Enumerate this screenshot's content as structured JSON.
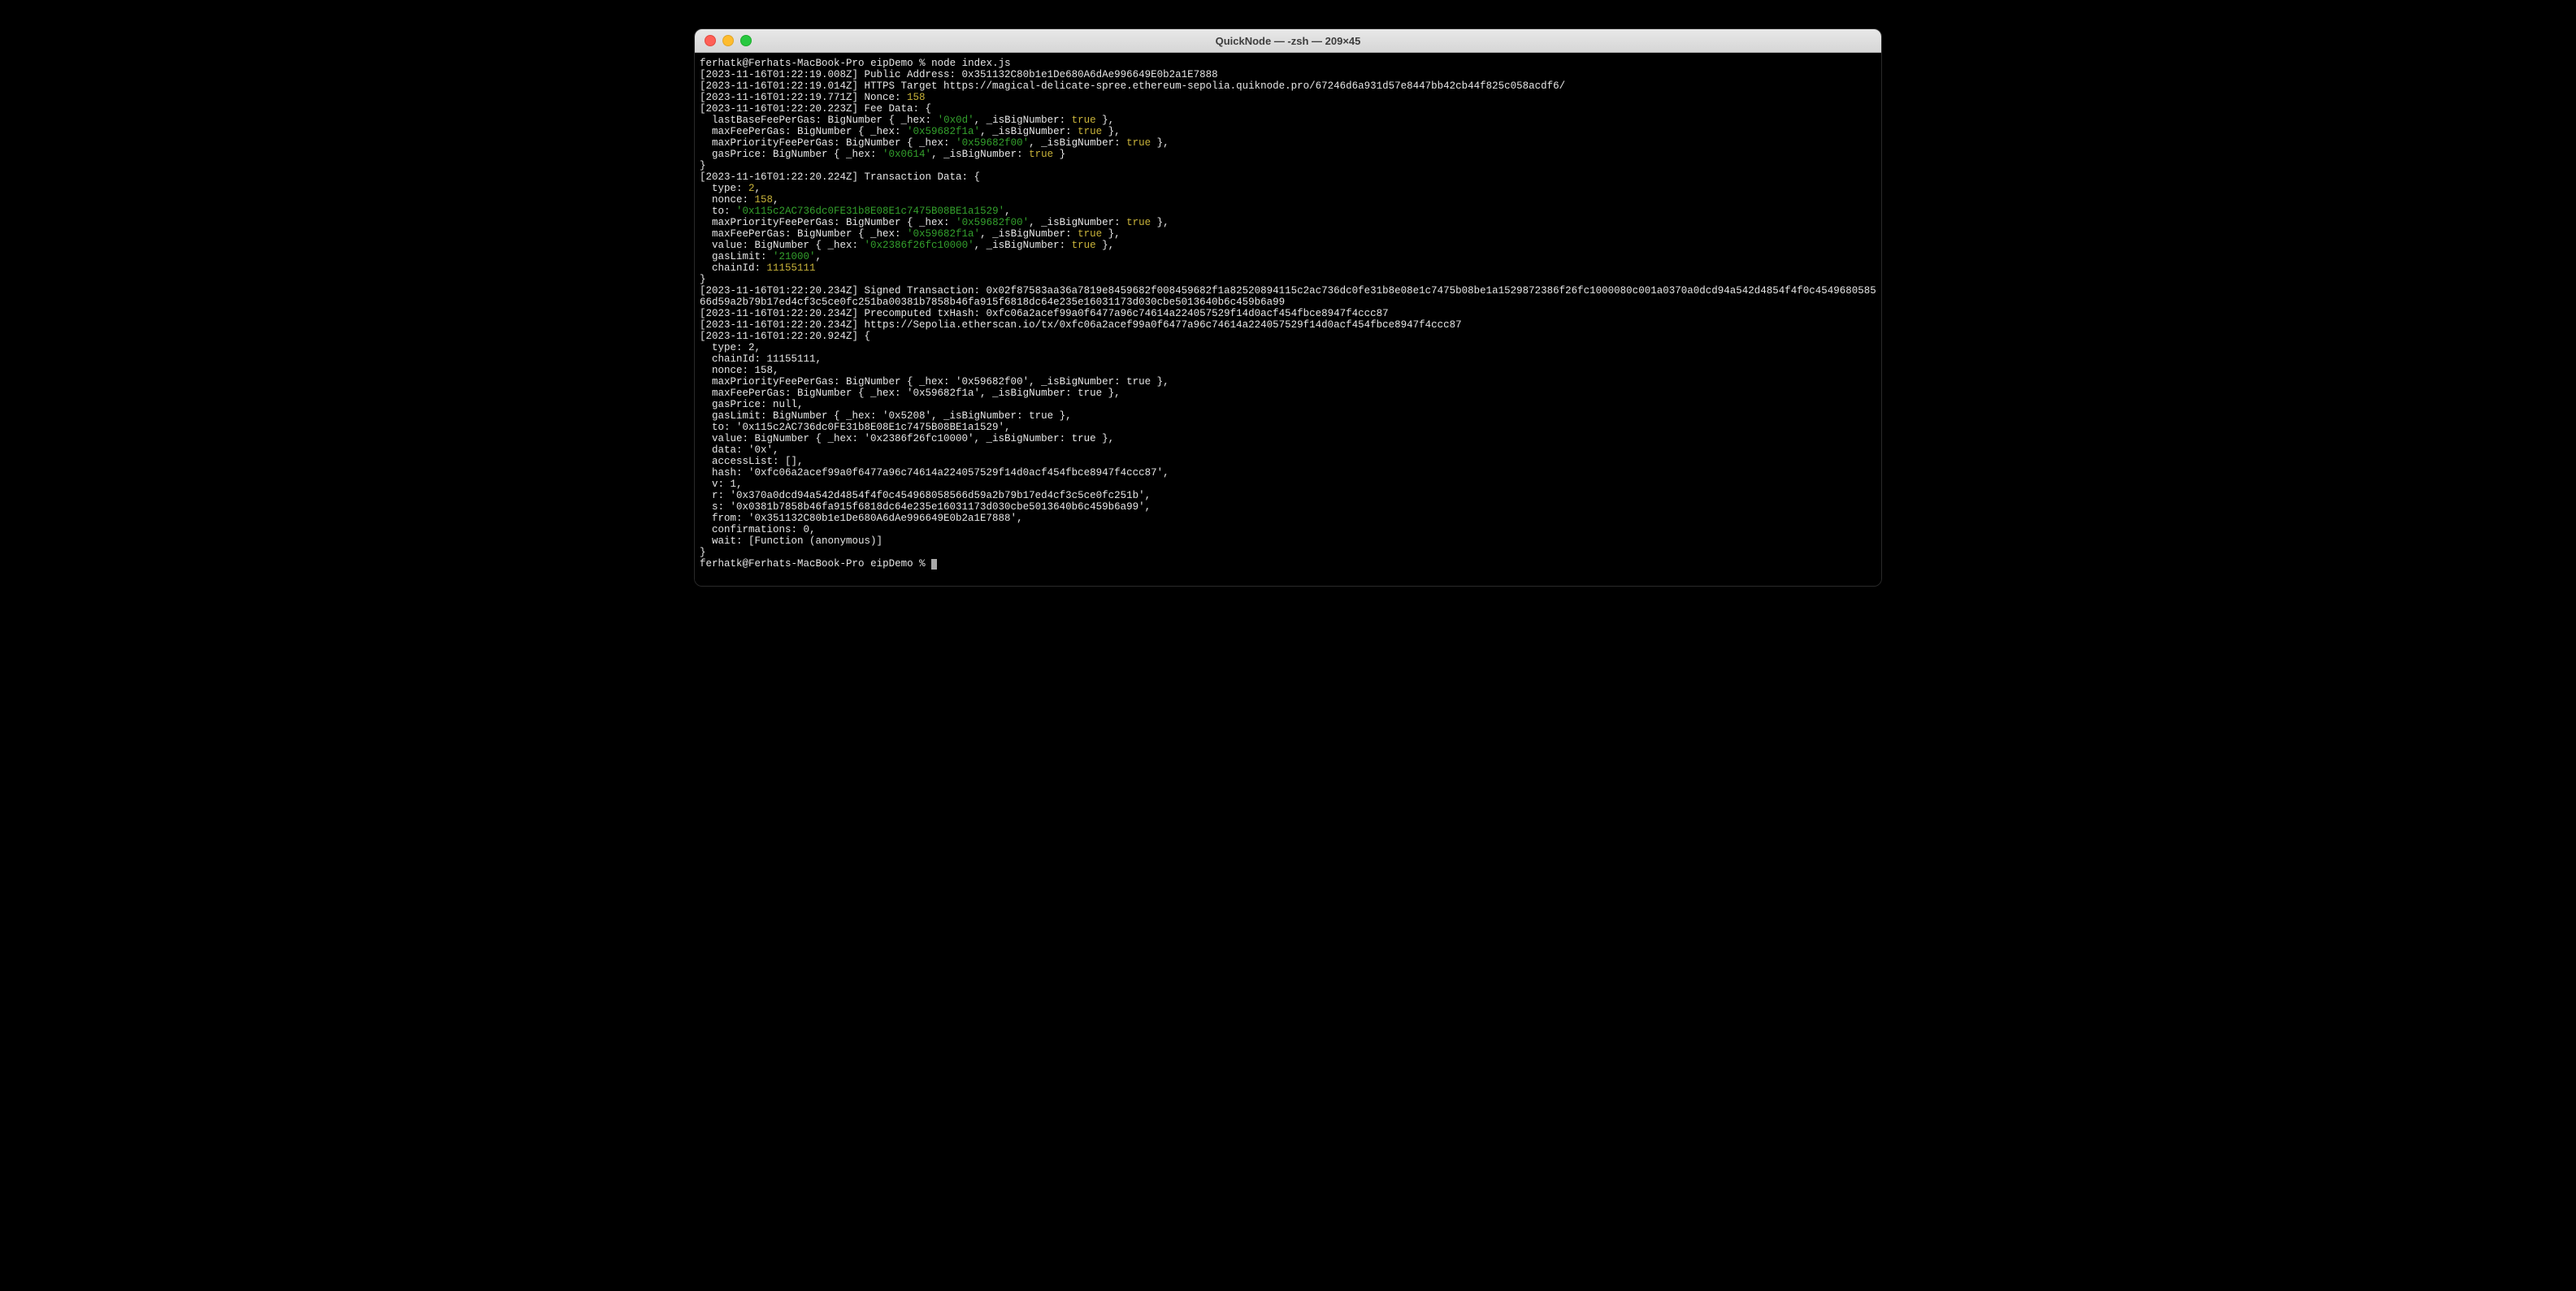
{
  "window": {
    "title": "QuickNode — -zsh — 209×45"
  },
  "prompt": {
    "user_host": "ferhatk@Ferhats-MacBook-Pro",
    "dir": "eipDemo",
    "symbol": "%",
    "command": "node index.js"
  },
  "lines": {
    "l1_ts": "[2023-11-16T01:22:19.008Z] Public Address: 0x351132C80b1e1De680A6dAe996649E0b2a1E7888",
    "l2_ts": "[2023-11-16T01:22:19.014Z] HTTPS Target https://magical-delicate-spree.ethereum-sepolia.quiknode.pro/67246d6a931d57e8447bb42cb44f825c058acdf6/",
    "nonce_prefix": "[2023-11-16T01:22:19.771Z] Nonce: ",
    "nonce_val": "158",
    "fee_head": "[2023-11-16T01:22:20.223Z] Fee Data: {",
    "fee1_a": "  lastBaseFeePerGas: BigNumber { _hex: ",
    "fee1_hex": "'0x0d'",
    "fee1_b": ", _isBigNumber: ",
    "fee1_true": "true",
    "fee1_c": " },",
    "fee2_a": "  maxFeePerGas: BigNumber { _hex: ",
    "fee2_hex": "'0x59682f1a'",
    "fee2_b": ", _isBigNumber: ",
    "fee2_true": "true",
    "fee2_c": " },",
    "fee3_a": "  maxPriorityFeePerGas: BigNumber { _hex: ",
    "fee3_hex": "'0x59682f00'",
    "fee3_b": ", _isBigNumber: ",
    "fee3_true": "true",
    "fee3_c": " },",
    "fee4_a": "  gasPrice: BigNumber { _hex: ",
    "fee4_hex": "'0x0614'",
    "fee4_b": ", _isBigNumber: ",
    "fee4_true": "true",
    "fee4_c": " }",
    "close_brace": "}",
    "tx_head": "[2023-11-16T01:22:20.224Z] Transaction Data: {",
    "tx_type_a": "  type: ",
    "tx_type_v": "2",
    "comma": ",",
    "tx_nonce_a": "  nonce: ",
    "tx_nonce_v": "158",
    "tx_to_a": "  to: ",
    "tx_to_v": "'0x115c2AC736dc0FE31b8E08E1c7475B08BE1a1529'",
    "tx_mpf_a": "  maxPriorityFeePerGas: BigNumber { _hex: ",
    "tx_mpf_hex": "'0x59682f00'",
    "tx_mpf_b": ", _isBigNumber: ",
    "tx_mpf_true": "true",
    "tx_mpf_c": " },",
    "tx_mf_a": "  maxFeePerGas: BigNumber { _hex: ",
    "tx_mf_hex": "'0x59682f1a'",
    "tx_mf_b": ", _isBigNumber: ",
    "tx_mf_true": "true",
    "tx_mf_c": " },",
    "tx_val_a": "  value: BigNumber { _hex: ",
    "tx_val_hex": "'0x2386f26fc10000'",
    "tx_val_b": ", _isBigNumber: ",
    "tx_val_true": "true",
    "tx_val_c": " },",
    "tx_gl_a": "  gasLimit: ",
    "tx_gl_v": "'21000'",
    "tx_ci_a": "  chainId: ",
    "tx_ci_v": "11155111",
    "signed_line": "[2023-11-16T01:22:20.234Z] Signed Transaction: 0x02f87583aa36a7819e8459682f008459682f1a82520894115c2ac736dc0fe31b8e08e1c7475b08be1a1529872386f26fc1000080c001a0370a0dcd94a542d4854f4f0c454968058566d59a2b79b17ed4cf3c5ce0fc251ba00381b7858b46fa915f6818dc64e235e16031173d030cbe5013640b6c459b6a99",
    "precomp_line": "[2023-11-16T01:22:20.234Z] Precomputed txHash: 0xfc06a2acef99a0f6477a96c74614a224057529f14d0acf454fbce8947f4ccc87",
    "etherscan_line": "[2023-11-16T01:22:20.234Z] https://Sepolia.etherscan.io/tx/0xfc06a2acef99a0f6477a96c74614a224057529f14d0acf454fbce8947f4ccc87",
    "resp_head": "[2023-11-16T01:22:20.924Z] {",
    "r_type": "  type: 2,",
    "r_chain": "  chainId: 11155111,",
    "r_nonce": "  nonce: 158,",
    "r_mpf": "  maxPriorityFeePerGas: BigNumber { _hex: '0x59682f00', _isBigNumber: true },",
    "r_mf": "  maxFeePerGas: BigNumber { _hex: '0x59682f1a', _isBigNumber: true },",
    "r_gp": "  gasPrice: null,",
    "r_gl": "  gasLimit: BigNumber { _hex: '0x5208', _isBigNumber: true },",
    "r_to": "  to: '0x115c2AC736dc0FE31b8E08E1c7475B08BE1a1529',",
    "r_val": "  value: BigNumber { _hex: '0x2386f26fc10000', _isBigNumber: true },",
    "r_data": "  data: '0x',",
    "r_al": "  accessList: [],",
    "r_hash": "  hash: '0xfc06a2acef99a0f6477a96c74614a224057529f14d0acf454fbce8947f4ccc87',",
    "r_v": "  v: 1,",
    "r_r": "  r: '0x370a0dcd94a542d4854f4f0c454968058566d59a2b79b17ed4cf3c5ce0fc251b',",
    "r_s": "  s: '0x0381b7858b46fa915f6818dc64e235e16031173d030cbe5013640b6c459b6a99',",
    "r_from": "  from: '0x351132C80b1e1De680A6dAe996649E0b2a1E7888',",
    "r_conf": "  confirmations: 0,",
    "r_wait": "  wait: [Function (anonymous)]"
  }
}
